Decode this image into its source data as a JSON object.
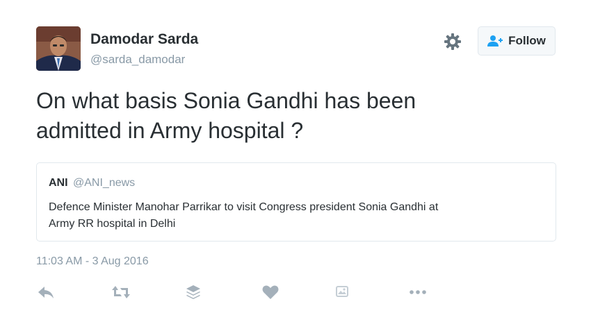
{
  "author": {
    "name": "Damodar Sarda",
    "handle": "@sarda_damodar"
  },
  "follow_button": {
    "label": "Follow"
  },
  "tweet": {
    "text_line1": "On what basis Sonia Gandhi has been",
    "text_line2": "admitted in Army hospital ?",
    "timestamp": "11:03 AM - 3 Aug 2016"
  },
  "quoted_tweet": {
    "name": "ANI",
    "handle": "@ANI_news",
    "text_line1": "Defence Minister Manohar Parrikar to visit Congress president Sonia Gandhi at",
    "text_line2": "Army RR hospital in Delhi"
  },
  "icons": {
    "settings": "gear-icon",
    "follow": "user-plus-icon",
    "actions": [
      "reply-icon",
      "retweet-icon",
      "buffer-icon",
      "like-icon",
      "media-icon",
      "more-icon"
    ]
  },
  "colors": {
    "text": "#292f33",
    "muted": "#8899a6",
    "icon": "#a4b0ba",
    "follow_icon": "#1da1f2",
    "border": "#e1e8ed",
    "button_bg": "#f5f8fa"
  }
}
